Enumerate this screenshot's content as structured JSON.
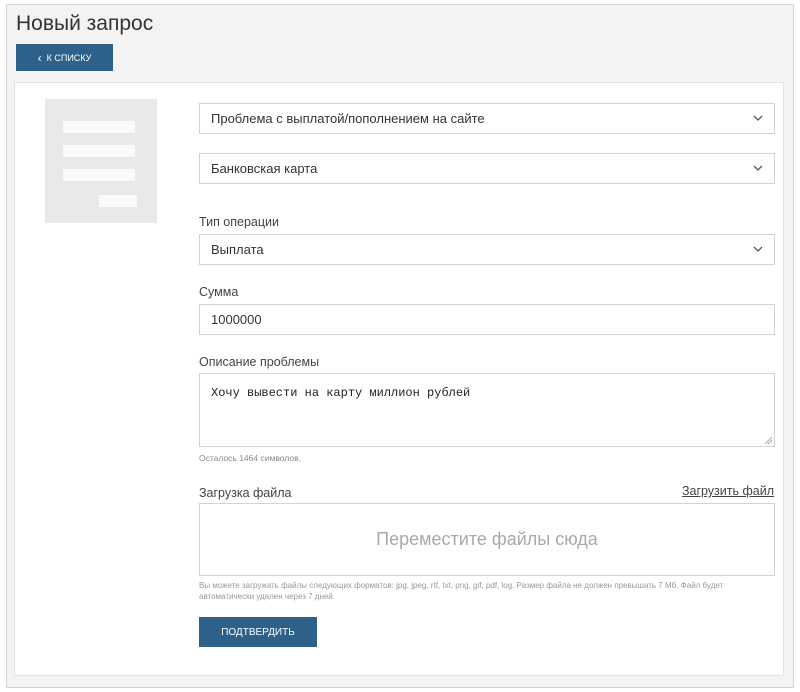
{
  "header": {
    "title": "Новый запрос",
    "back_label": "К списку"
  },
  "form": {
    "category": {
      "value": "Проблема с выплатой/пополнением на сайте"
    },
    "method": {
      "value": "Банковская карта"
    },
    "operation_type": {
      "label": "Тип операции",
      "value": "Выплата"
    },
    "amount": {
      "label": "Сумма",
      "value": "1000000"
    },
    "description": {
      "label": "Описание проблемы",
      "value": "Хочу вывести на карту миллион рублей",
      "counter": "Осталось 1464 символов."
    },
    "upload": {
      "label": "Загрузка файла",
      "link": "Загрузить файл",
      "dropzone": "Переместите файлы сюда",
      "hint": "Вы можете загружать файлы следующих форматов: jpg, jpeg, rtf, txt, png, gif, pdf, log. Размер файла не должен превышать 7 Мб. Файл будет автоматически удален через 7 дней."
    },
    "submit_label": "Подтвердить"
  },
  "icons": {
    "back": "chevron-left-icon",
    "dropdown": "chevron-down-icon",
    "resize": "resize-grip-icon",
    "illustration": "form-document-icon"
  },
  "colors": {
    "accent": "#2e6189",
    "page_bg": "#f3f3f3",
    "panel_bg": "#ffffff",
    "border": "#d3d3d3"
  }
}
